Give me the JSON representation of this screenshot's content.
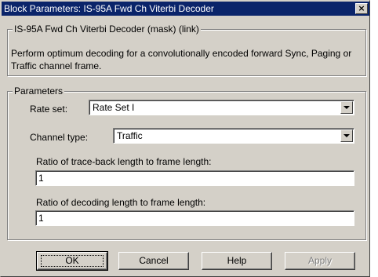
{
  "window": {
    "title": "Block Parameters: IS-95A Fwd Ch Viterbi Decoder",
    "close_glyph": "×"
  },
  "mask_group": {
    "legend": "IS-95A Fwd Ch Viterbi Decoder (mask) (link)",
    "description": "Perform optimum decoding for a convolutionally encoded forward Sync, Paging or Traffic channel frame."
  },
  "parameters_group": {
    "legend": "Parameters",
    "rate_set": {
      "label": "Rate set:",
      "value": "Rate Set I"
    },
    "channel_type": {
      "label": "Channel type:",
      "value": "Traffic"
    },
    "traceback_ratio": {
      "label": "Ratio of trace-back length to frame length:",
      "value": "1"
    },
    "decoding_ratio": {
      "label": "Ratio of decoding length to frame length:",
      "value": "1"
    }
  },
  "buttons": {
    "ok": "OK",
    "cancel": "Cancel",
    "help": "Help",
    "apply": "Apply"
  },
  "icons": {
    "close": "close-icon",
    "dropdown": "chevron-down-icon"
  },
  "colors": {
    "titlebar_bg": "#0a246a",
    "dialog_bg": "#d4d0c8",
    "disabled_text": "#808080"
  }
}
